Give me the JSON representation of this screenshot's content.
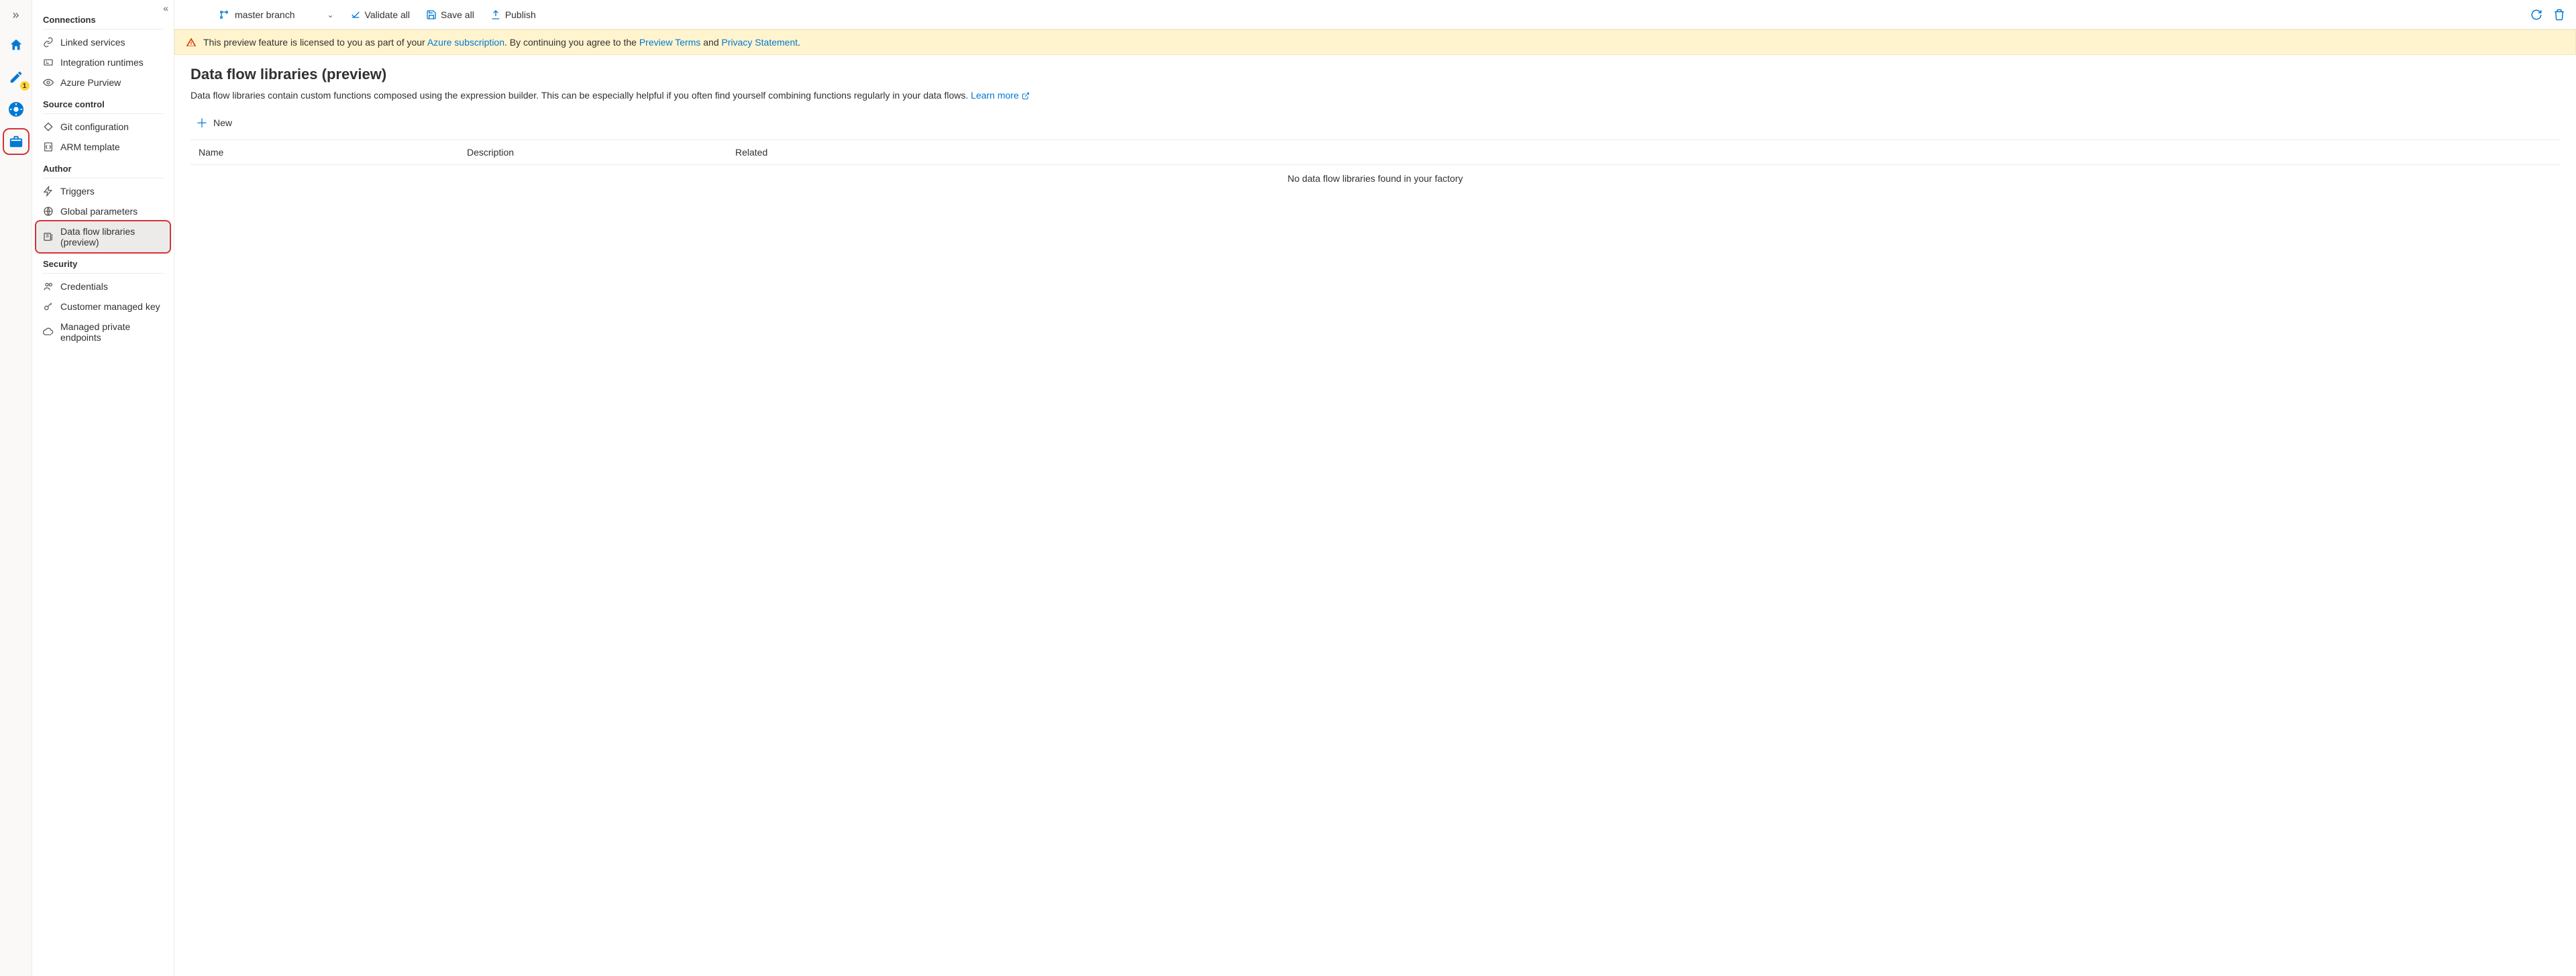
{
  "rail": {
    "expand_tip": "Expand",
    "author_badge": "1"
  },
  "toolbar": {
    "branch_label": "master branch",
    "validate_label": "Validate all",
    "save_label": "Save all",
    "publish_label": "Publish"
  },
  "banner": {
    "pre": "This preview feature is licensed to you as part of your ",
    "link1": "Azure subscription",
    "mid1": ". By continuing you agree to the ",
    "link2": "Preview Terms",
    "mid2": " and ",
    "link3": "Privacy Statement",
    "post": "."
  },
  "manage": {
    "sections": {
      "connections": {
        "header": "Connections",
        "items": [
          "Linked services",
          "Integration runtimes",
          "Azure Purview"
        ]
      },
      "source_control": {
        "header": "Source control",
        "items": [
          "Git configuration",
          "ARM template"
        ]
      },
      "author": {
        "header": "Author",
        "items": [
          "Triggers",
          "Global parameters",
          "Data flow libraries (preview)"
        ]
      },
      "security": {
        "header": "Security",
        "items": [
          "Credentials",
          "Customer managed key",
          "Managed private endpoints"
        ]
      }
    }
  },
  "page": {
    "title": "Data flow libraries (preview)",
    "desc_pre": "Data flow libraries contain custom functions composed using the expression builder. This can be especially helpful if you often find yourself combining functions regularly in your data flows. ",
    "learn_more": "Learn more",
    "new_label": "New",
    "columns": {
      "name": "Name",
      "description": "Description",
      "related": "Related"
    },
    "empty": "No data flow libraries found in your factory"
  }
}
